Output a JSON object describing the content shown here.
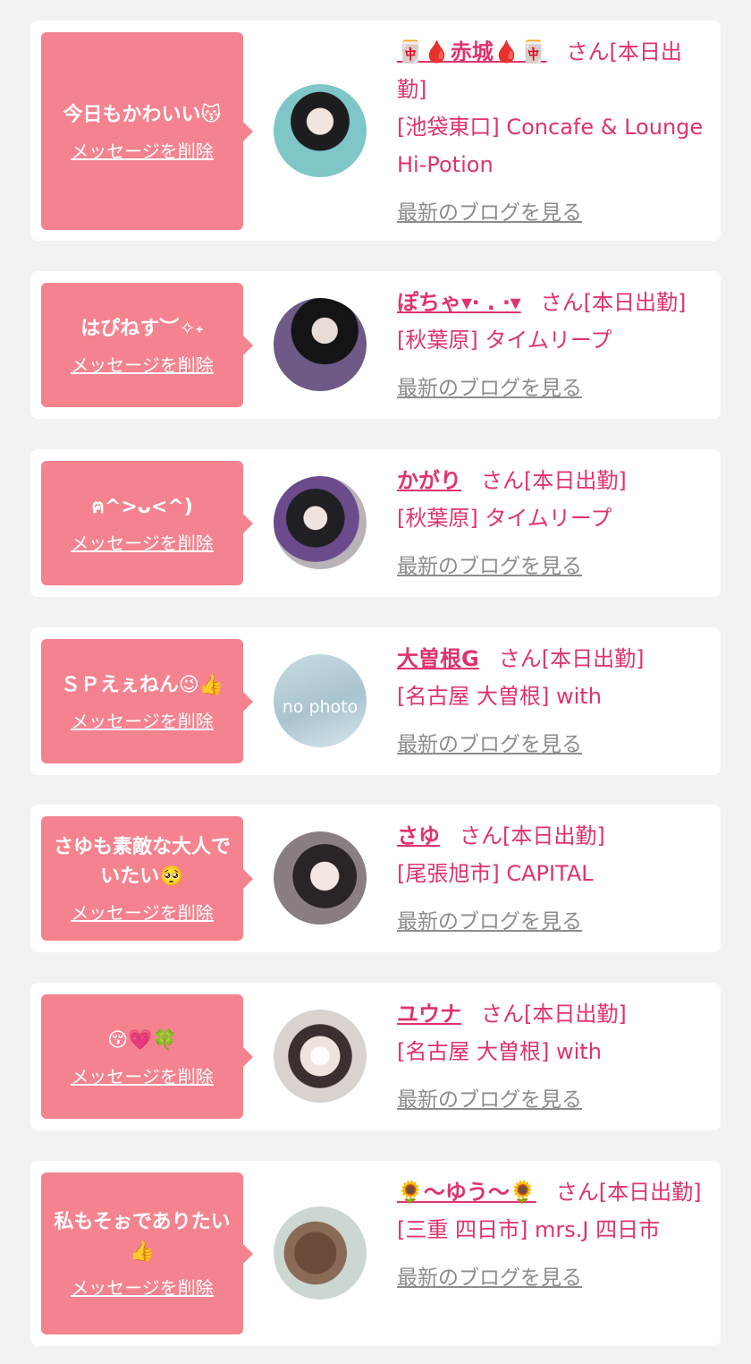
{
  "colors": {
    "accent": "#e0336b",
    "bubble": "#f5838f",
    "link_gray": "#8c8c8c",
    "page_bg": "#f2f2f2"
  },
  "labels": {
    "delete_message": "メッセージを削除",
    "san_suffix": "さん[本日出勤]",
    "latest_blog": "最新のブログを見る"
  },
  "cards": [
    {
      "message": "今日もかわいい😽",
      "name": "🀄🩸赤城🩸🀄",
      "shop": "[池袋東口] Concafe & Lounge Hi-Potion",
      "avatar": "photo"
    },
    {
      "message": "はぴねす︶✧˖",
      "name": "ぽちゃ▾‧ . ‧▾",
      "shop": "[秋葉原] タイムリープ",
      "avatar": "photo"
    },
    {
      "message": "ฅ^>ᴗ<^)",
      "name": "かがり",
      "shop": "[秋葉原] タイムリープ",
      "avatar": "photo"
    },
    {
      "message": "ＳＰえぇねん😉👍",
      "name": "大曽根G",
      "shop": "[名古屋 大曽根] with",
      "avatar": "no-photo",
      "avatar_text": "no photo"
    },
    {
      "message": "さゆも素敵な大人でいたい🥺",
      "name": "さゆ",
      "shop": "[尾張旭市] CAPITAL",
      "avatar": "photo"
    },
    {
      "message": "😚💗🍀",
      "name": "ユウナ",
      "shop": "[名古屋 大曽根] with",
      "avatar": "photo"
    },
    {
      "message": "私もそぉでありたい👍",
      "name": "🌻〜ゆう〜🌻",
      "shop": "[三重 四日市] mrs.J 四日市",
      "avatar": "photo"
    }
  ]
}
